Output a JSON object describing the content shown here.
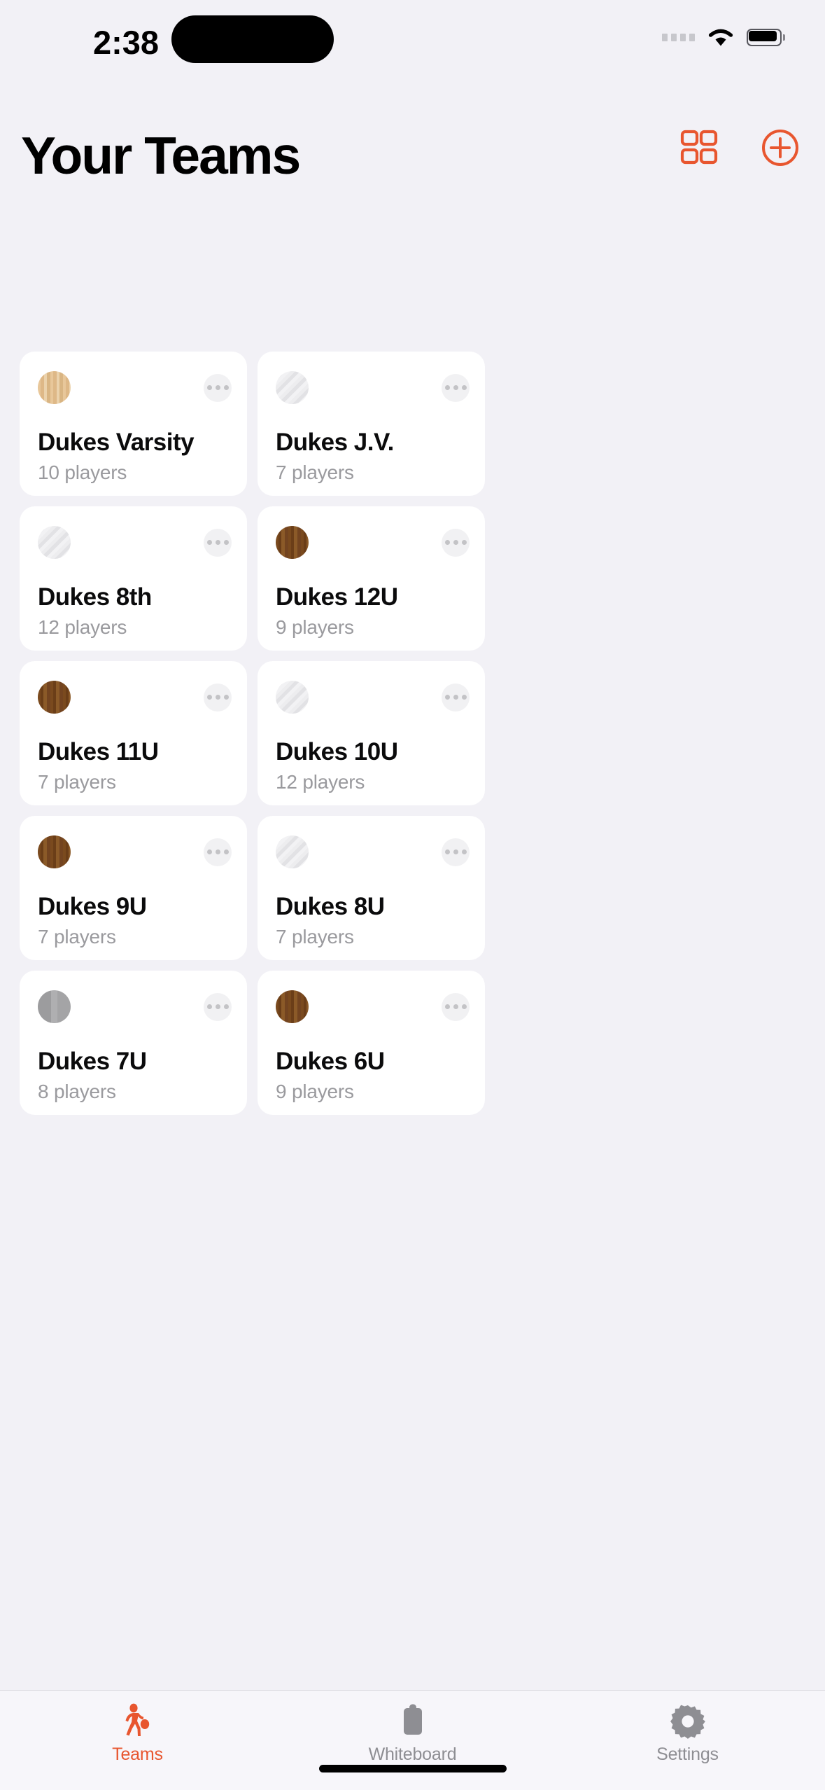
{
  "status_bar": {
    "time": "2:38",
    "cellular_icon": "cellular-dots-icon",
    "wifi_icon": "wifi-icon",
    "battery_icon": "battery-icon"
  },
  "toolbar": {
    "grid_icon": "grid-view-icon",
    "add_icon": "plus-circle-icon",
    "accent_color": "#E8562F"
  },
  "header": {
    "title": "Your Teams"
  },
  "teams": [
    {
      "name": "Dukes Varsity",
      "players": "10 players",
      "avatar": "tan-wood",
      "more_icon": "more-options-icon"
    },
    {
      "name": "Dukes J.V.",
      "players": "7 players",
      "avatar": "light-diagonal",
      "more_icon": "more-options-icon"
    },
    {
      "name": "Dukes 8th",
      "players": "12 players",
      "avatar": "light-diagonal",
      "more_icon": "more-options-icon"
    },
    {
      "name": "Dukes 12U",
      "players": "9 players",
      "avatar": "dark-brown",
      "more_icon": "more-options-icon"
    },
    {
      "name": "Dukes 11U",
      "players": "7 players",
      "avatar": "dark-brown",
      "more_icon": "more-options-icon"
    },
    {
      "name": "Dukes 10U",
      "players": "12 players",
      "avatar": "light-diagonal",
      "more_icon": "more-options-icon"
    },
    {
      "name": "Dukes 9U",
      "players": "7 players",
      "avatar": "dark-brown",
      "more_icon": "more-options-icon"
    },
    {
      "name": "Dukes 8U",
      "players": "7 players",
      "avatar": "light-diagonal",
      "more_icon": "more-options-icon"
    },
    {
      "name": "Dukes 7U",
      "players": "8 players",
      "avatar": "gray-solid",
      "more_icon": "more-options-icon"
    },
    {
      "name": "Dukes 6U",
      "players": "9 players",
      "avatar": "dark-brown",
      "more_icon": "more-options-icon"
    }
  ],
  "tab_bar": {
    "items": [
      {
        "label": "Teams",
        "icon": "basketball-player-icon",
        "active": true
      },
      {
        "label": "Whiteboard",
        "icon": "clipboard-icon",
        "active": false
      },
      {
        "label": "Settings",
        "icon": "gear-icon",
        "active": false
      }
    ],
    "active_color": "#E8562F",
    "inactive_color": "#8E8E93"
  }
}
